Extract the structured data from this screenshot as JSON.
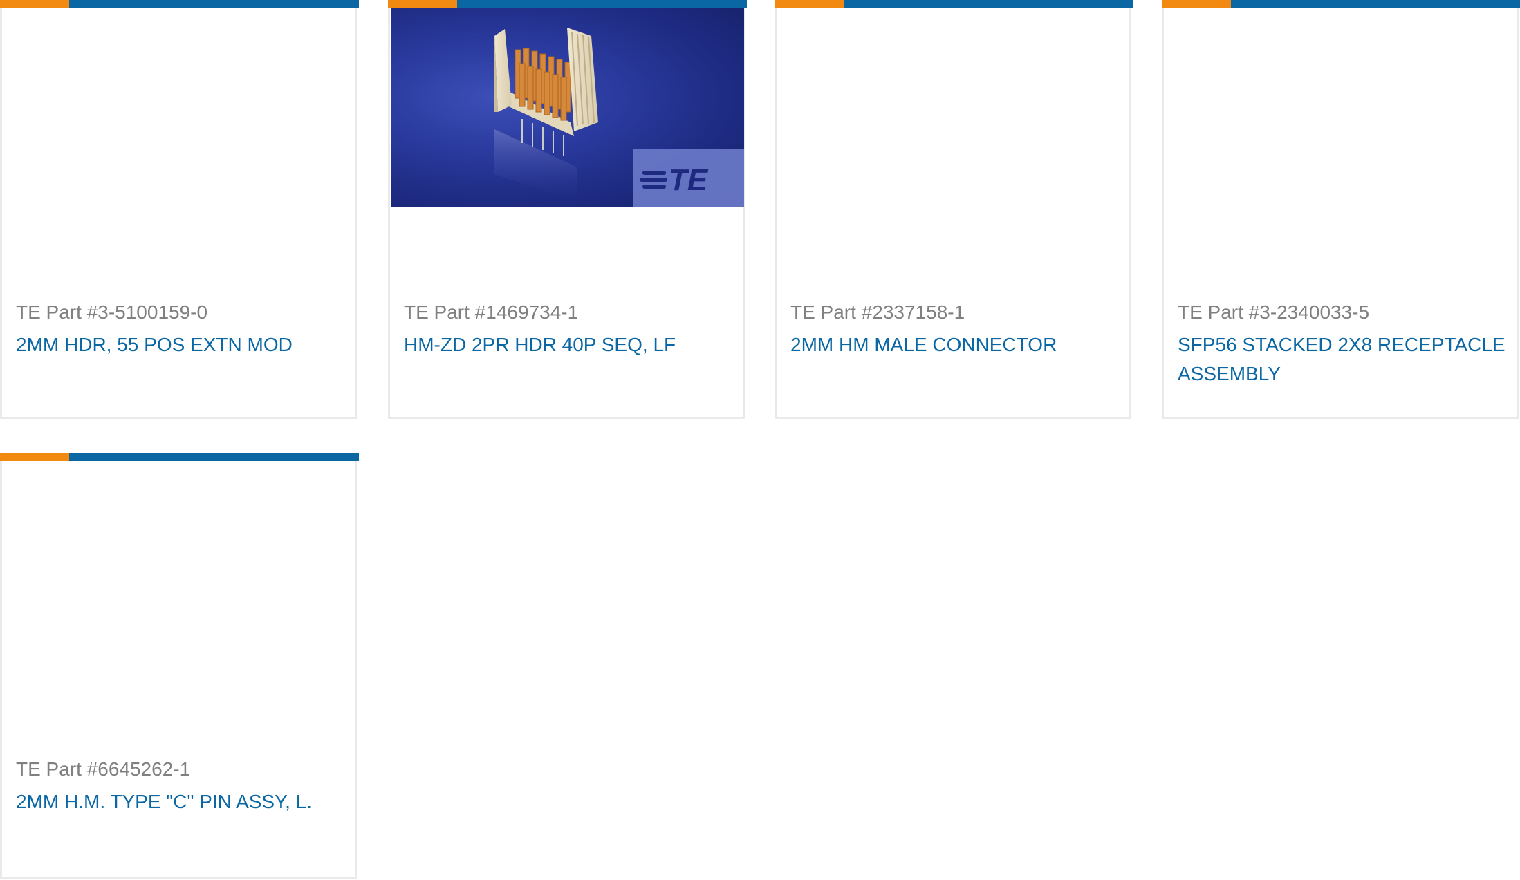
{
  "products": [
    {
      "part_number": "TE Part #3-5100159-0",
      "description": "2MM HDR, 55 POS EXTN MOD",
      "has_image": false
    },
    {
      "part_number": "TE Part #1469734-1",
      "description": "HM-ZD 2PR HDR 40P SEQ, LF",
      "has_image": true,
      "image_logo": "TE"
    },
    {
      "part_number": "TE Part #2337158-1",
      "description": "2MM HM MALE CONNECTOR",
      "has_image": false
    },
    {
      "part_number": "TE Part #3-2340033-5",
      "description": "SFP56 STACKED 2X8 RECEPTACLE ASSEMBLY",
      "has_image": false
    },
    {
      "part_number": "TE Part #6645262-1",
      "description": "2MM H.M. TYPE \"C\" PIN ASSY, L.",
      "has_image": false
    }
  ],
  "colors": {
    "accent_orange": "#f28a12",
    "brand_blue": "#0a67a3",
    "part_number_gray": "#808080",
    "card_border": "#e9eaec"
  }
}
